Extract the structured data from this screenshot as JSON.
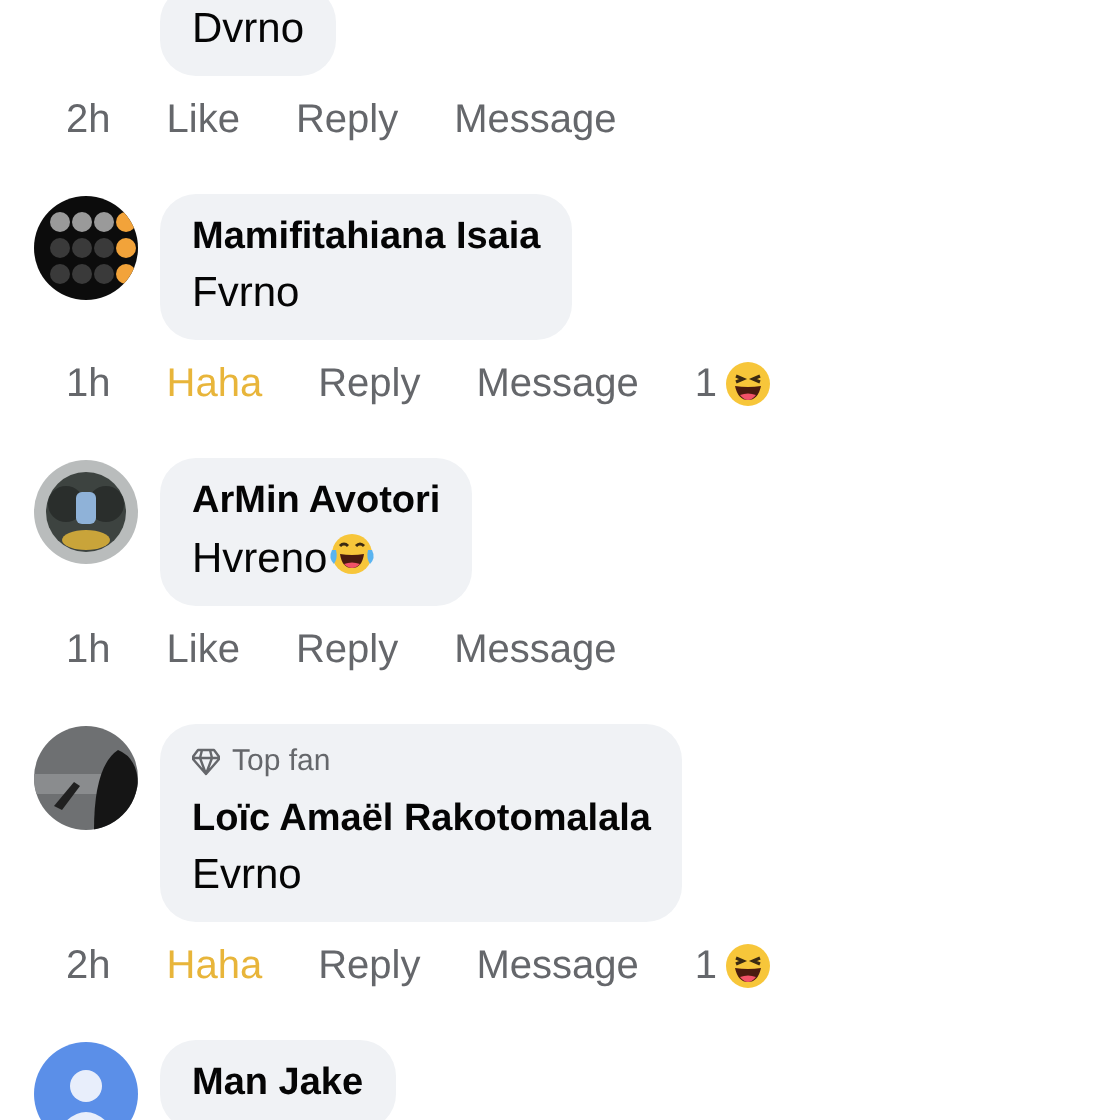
{
  "comments": [
    {
      "text": "Dvrno",
      "time": "2h",
      "reaction_button": {
        "label": "Like",
        "selected": false
      },
      "reply": "Reply",
      "message": "Message"
    },
    {
      "author": "Mamifitahiana Isaia",
      "text": "Fvrno",
      "time": "1h",
      "reaction_button": {
        "label": "Haha",
        "selected": true
      },
      "reply": "Reply",
      "message": "Message",
      "reaction_count": "1"
    },
    {
      "author": "ArMin Avotori",
      "text": "Hvreno",
      "trailing_emoji": true,
      "time": "1h",
      "reaction_button": {
        "label": "Like",
        "selected": false
      },
      "reply": "Reply",
      "message": "Message"
    },
    {
      "badge": "Top fan",
      "author": "Loïc Amaël Rakotomalala",
      "text": "Evrno",
      "time": "2h",
      "reaction_button": {
        "label": "Haha",
        "selected": true
      },
      "reply": "Reply",
      "message": "Message",
      "reaction_count": "1"
    },
    {
      "author": "Man Jake"
    }
  ]
}
